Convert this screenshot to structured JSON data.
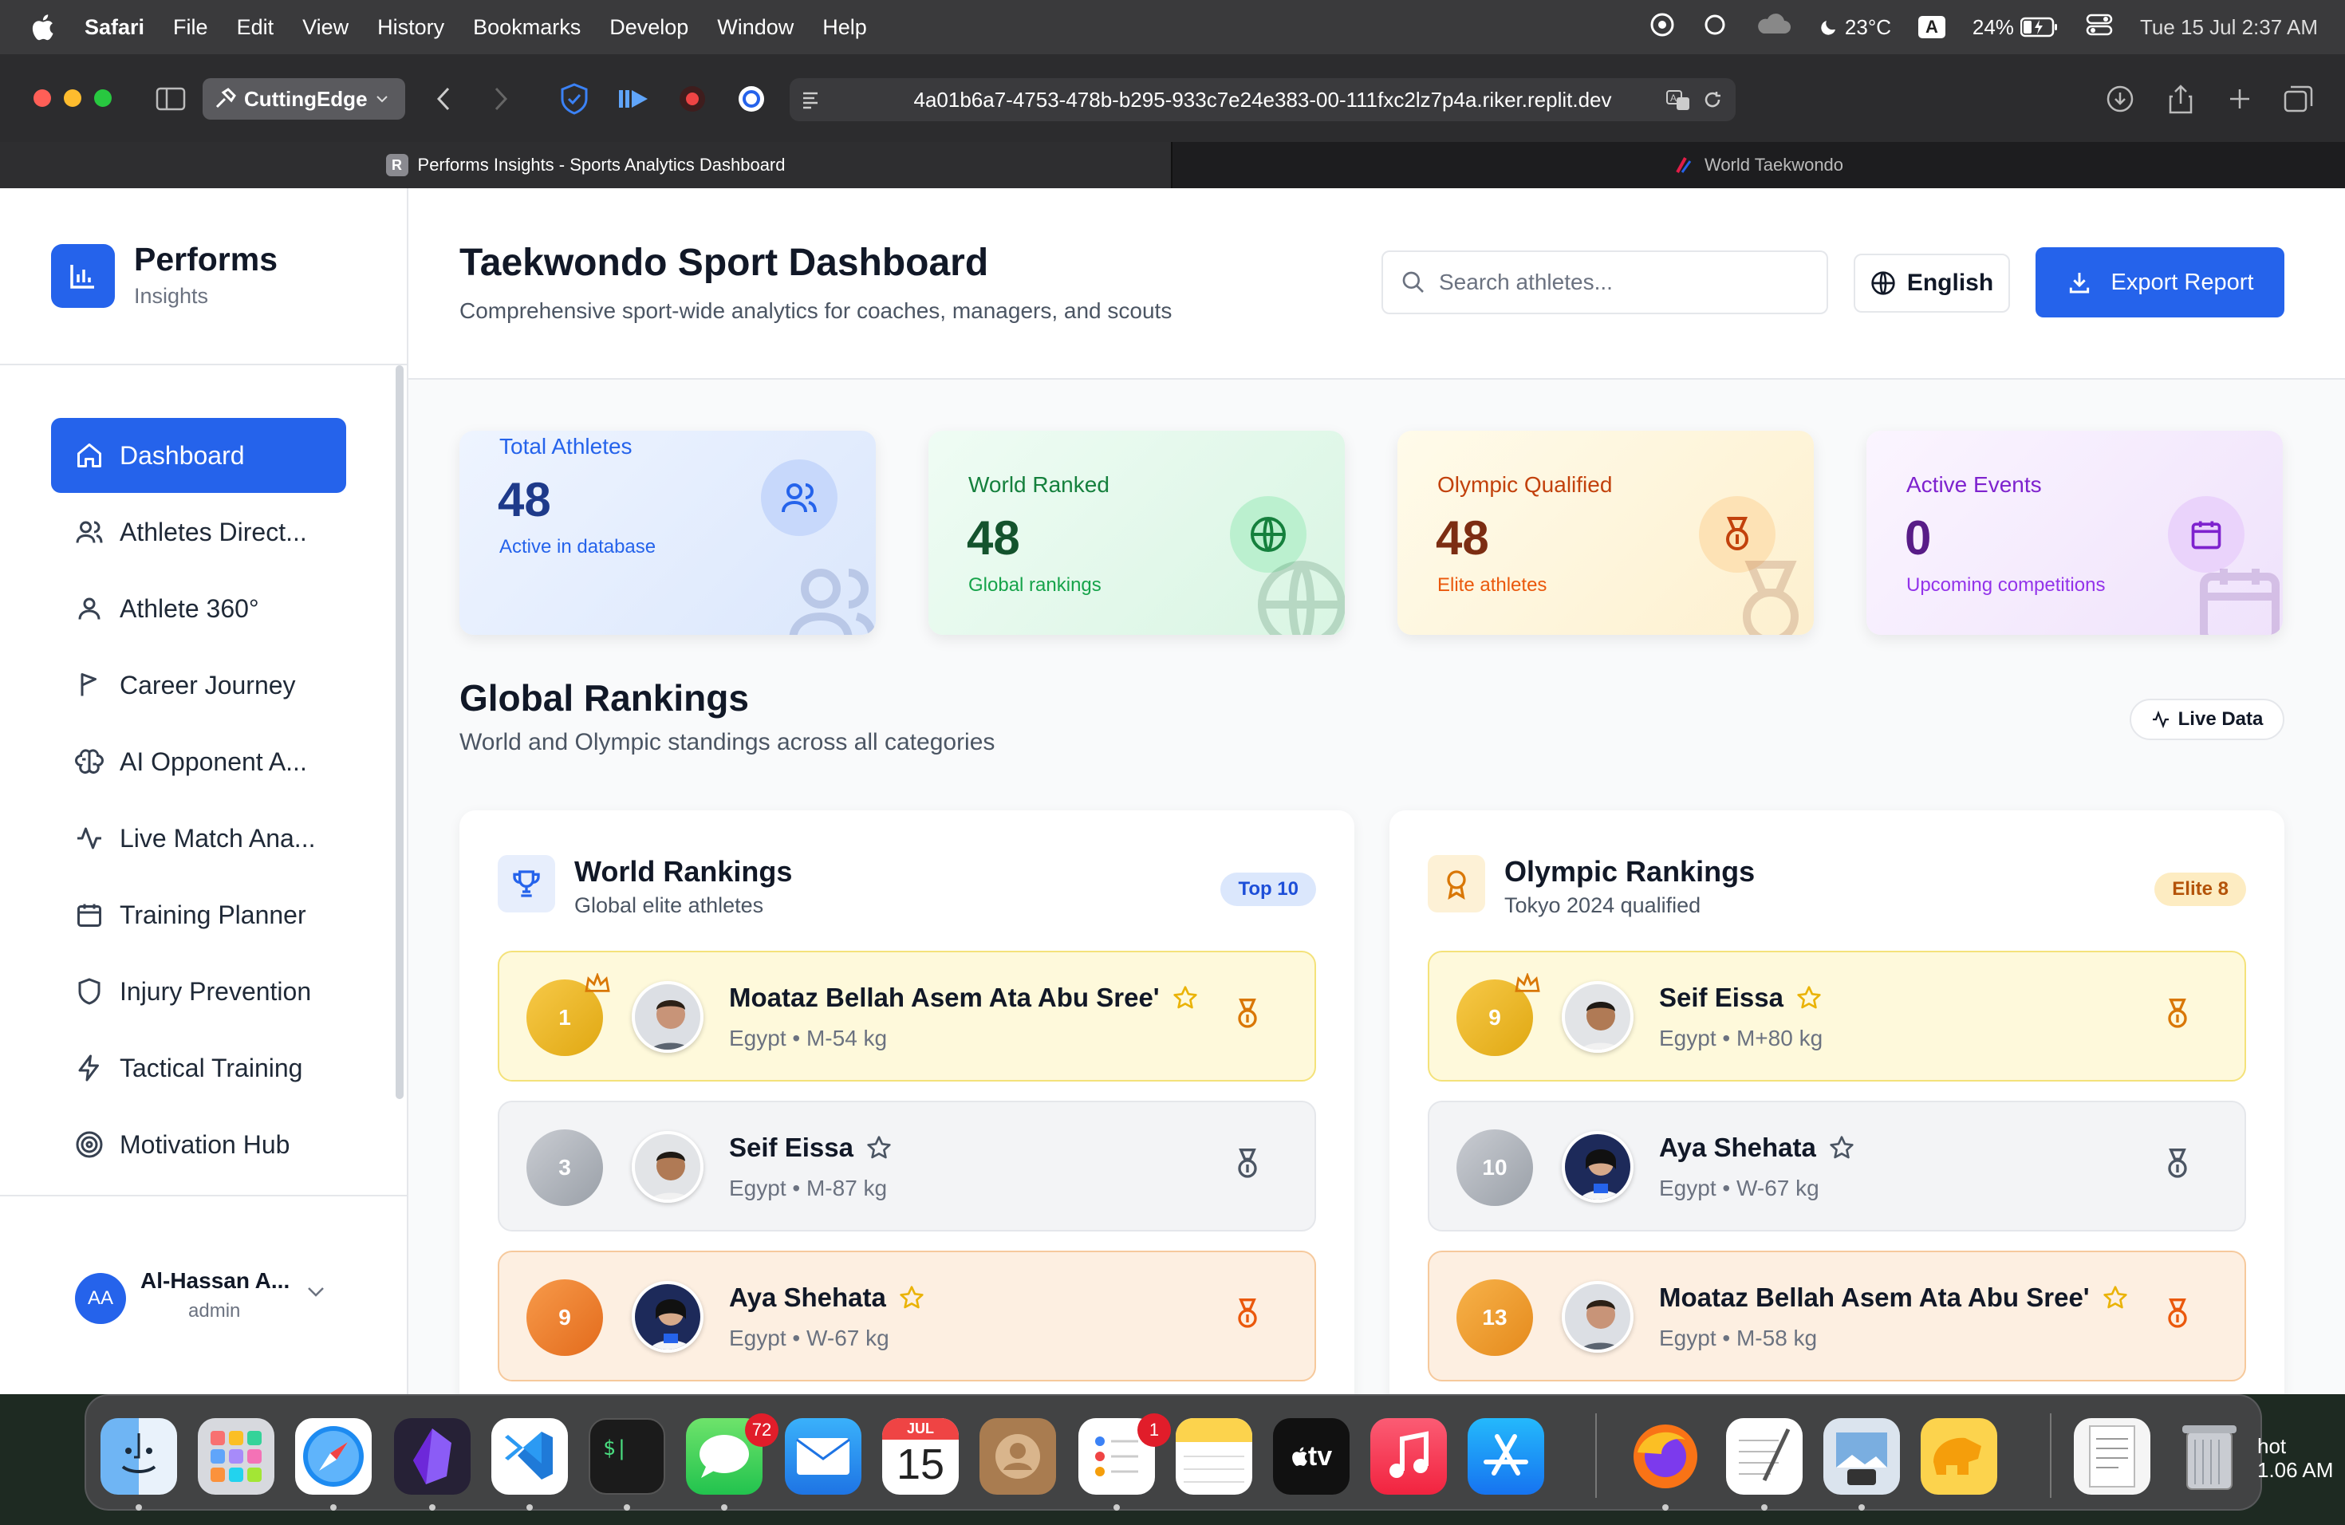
{
  "menubar": {
    "app": "Safari",
    "items": [
      "File",
      "Edit",
      "View",
      "History",
      "Bookmarks",
      "Develop",
      "Window",
      "Help"
    ],
    "temperature": "23°C",
    "input_source": "A",
    "battery": "24%",
    "datetime": "Tue 15 Jul  2:37 AM"
  },
  "browser": {
    "tab_group": "CuttingEdge",
    "url": "4a01b6a7-4753-478b-b295-933c7e24e383-00-111fxc2lz7p4a.riker.replit.dev",
    "tabs": [
      {
        "favicon": "R",
        "title": "Performs Insights - Sports Analytics Dashboard",
        "active": true
      },
      {
        "favicon": "world-taekwondo-icon",
        "title": "World Taekwondo",
        "active": false
      }
    ]
  },
  "brand": {
    "name": "Performs",
    "tagline": "Insights"
  },
  "nav": [
    {
      "label": "Dashboard",
      "icon": "home-icon",
      "active": true
    },
    {
      "label": "Athletes Direct...",
      "icon": "users-icon"
    },
    {
      "label": "Athlete 360°",
      "icon": "user-icon"
    },
    {
      "label": "Career Journey",
      "icon": "flag-icon"
    },
    {
      "label": "AI Opponent A...",
      "icon": "brain-icon"
    },
    {
      "label": "Live Match Ana...",
      "icon": "activity-icon"
    },
    {
      "label": "Training Planner",
      "icon": "calendar-icon"
    },
    {
      "label": "Injury Prevention",
      "icon": "shield-icon"
    },
    {
      "label": "Tactical Training",
      "icon": "zap-icon"
    },
    {
      "label": "Motivation Hub",
      "icon": "target-icon"
    }
  ],
  "user": {
    "initials": "AA",
    "name": "Al-Hassan A...",
    "role": "admin"
  },
  "header": {
    "title": "Taekwondo Sport Dashboard",
    "subtitle": "Comprehensive sport-wide analytics for coaches, managers, and scouts",
    "search_placeholder": "Search athletes...",
    "language": "English",
    "export_label": "Export Report",
    "accent": "#2563eb"
  },
  "stats": [
    {
      "label": "Total Athletes",
      "value": "48",
      "caption": "Active in database",
      "icon": "users-icon",
      "color": "#2563eb"
    },
    {
      "label": "World Ranked",
      "value": "48",
      "caption": "Global rankings",
      "icon": "globe-icon",
      "color": "#15803d"
    },
    {
      "label": "Olympic Qualified",
      "value": "48",
      "caption": "Elite athletes",
      "icon": "medal-icon",
      "color": "#c2410c"
    },
    {
      "label": "Active Events",
      "value": "0",
      "caption": "Upcoming competitions",
      "icon": "calendar-icon",
      "color": "#7e22ce"
    }
  ],
  "rankings_section": {
    "title": "Global Rankings",
    "subtitle": "World and Olympic standings across all categories",
    "live_label": "Live Data"
  },
  "world_rankings": {
    "title": "World Rankings",
    "subtitle": "Global elite athletes",
    "badge": "Top 10",
    "rows": [
      {
        "rank": "1",
        "name": "Moataz Bellah Asem Ata Abu Sree'",
        "country": "Egypt",
        "category": "M-54 kg",
        "tier": "gold",
        "crown": true
      },
      {
        "rank": "3",
        "name": "Seif Eissa",
        "country": "Egypt",
        "category": "M-87 kg",
        "tier": "silver",
        "crown": false
      },
      {
        "rank": "9",
        "name": "Aya Shehata",
        "country": "Egypt",
        "category": "W-67 kg",
        "tier": "bronze",
        "crown": false
      }
    ]
  },
  "olympic_rankings": {
    "title": "Olympic Rankings",
    "subtitle": "Tokyo 2024 qualified",
    "badge": "Elite 8",
    "rows": [
      {
        "rank": "9",
        "name": "Seif Eissa",
        "country": "Egypt",
        "category": "M+80 kg",
        "tier": "gold",
        "crown": true
      },
      {
        "rank": "10",
        "name": "Aya Shehata",
        "country": "Egypt",
        "category": "W-67 kg",
        "tier": "silver",
        "crown": false
      },
      {
        "rank": "13",
        "name": "Moataz Bellah Asem Ata Abu Sree'",
        "country": "Egypt",
        "category": "M-58 kg",
        "tier": "bronze",
        "crown": false
      }
    ]
  },
  "dock": {
    "apps": [
      "Finder",
      "Launchpad",
      "Safari",
      "Obsidian",
      "Visual Studio Code",
      "Terminal",
      "Messages",
      "Mail",
      "Calendar",
      "Contacts",
      "Reminders",
      "Notes",
      "TV",
      "Music",
      "App Store",
      "Firefox",
      "TextEdit",
      "Preview",
      "TablePlus",
      "Documents",
      "Trash"
    ],
    "messages_badge": "72",
    "reminders_badge": "1",
    "calendar_month": "JUL",
    "calendar_day": "15",
    "tv_label": "tv",
    "clock_fragment": [
      "hot",
      "1.06 AM"
    ]
  }
}
